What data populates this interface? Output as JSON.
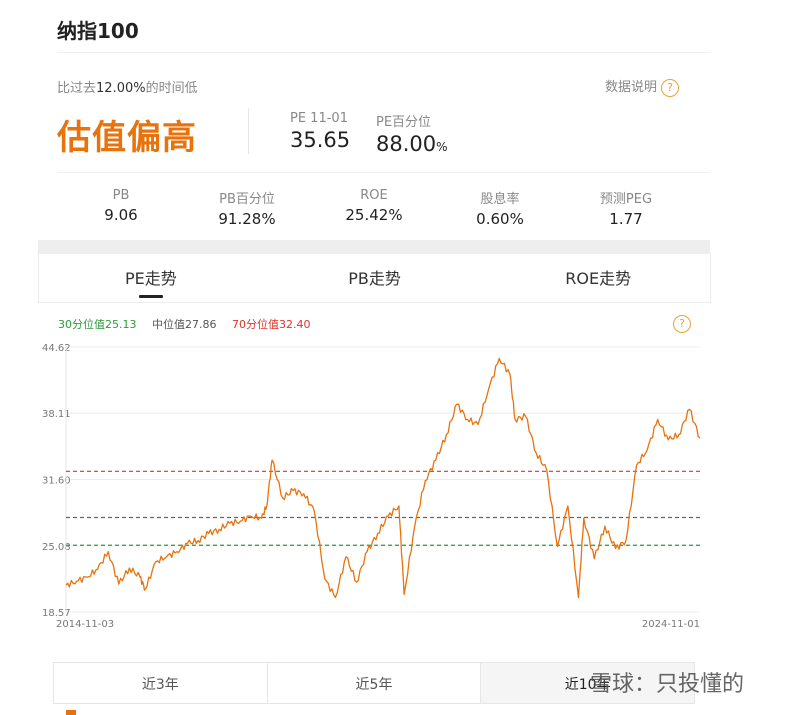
{
  "header": {
    "title": "纳指100"
  },
  "valuation": {
    "subtitle_prefix": "比过去",
    "subtitle_percent": "12.00%",
    "subtitle_suffix": "的时间低",
    "help_label": "数据说明",
    "status": "估值偏高",
    "pe_label": "PE 11-01",
    "pe_value": "35.65",
    "pe_percentile_label": "PE百分位",
    "pe_percentile_value": "88.00",
    "pe_percentile_unit": "%"
  },
  "stats": [
    {
      "label": "PB",
      "value": "9.06"
    },
    {
      "label": "PB百分位",
      "value": "91.28%"
    },
    {
      "label": "ROE",
      "value": "25.42%"
    },
    {
      "label": "股息率",
      "value": "0.60%"
    },
    {
      "label": "预测PEG",
      "value": "1.77"
    }
  ],
  "tabs": [
    {
      "label": "PE走势",
      "active": true
    },
    {
      "label": "PB走势",
      "active": false
    },
    {
      "label": "ROE走势",
      "active": false
    }
  ],
  "legend": {
    "p30": "30分位值25.13",
    "median": "中位值27.86",
    "p70": "70分位值32.40",
    "colors": {
      "p30": "#2e9a3c",
      "median": "#666666",
      "p70": "#d9342b",
      "line": "#e8720c"
    }
  },
  "periods": [
    "近3年",
    "近5年",
    "近10年"
  ],
  "watermark": "雪球：只投懂的",
  "chart_data": {
    "type": "line",
    "title": "",
    "xlabel": "",
    "ylabel": "",
    "x_start": "2014-11-03",
    "x_end": "2024-11-01",
    "yticks": [
      18.57,
      25.08,
      31.6,
      38.11,
      44.62
    ],
    "ytick_labels": [
      "18.57",
      "25.08",
      "31.60",
      "38.11",
      "44.62"
    ],
    "ylim": [
      18.57,
      44.62
    ],
    "grid": true,
    "reference_lines": [
      {
        "name": "30分位值",
        "value": 25.13,
        "color": "#2e9a3c"
      },
      {
        "name": "中位值",
        "value": 27.86,
        "color": "#666666"
      },
      {
        "name": "70分位值",
        "value": 32.4,
        "color": "#d9342b"
      }
    ],
    "series": [
      {
        "x": [
          "2014-11",
          "2015-01",
          "2015-03",
          "2015-05",
          "2015-07",
          "2015-09",
          "2015-11",
          "2016-01",
          "2016-02",
          "2016-04",
          "2016-06",
          "2016-08",
          "2016-10",
          "2016-12",
          "2017-02",
          "2017-04",
          "2017-06",
          "2017-08",
          "2017-10",
          "2017-12",
          "2018-01",
          "2018-02",
          "2018-04",
          "2018-06",
          "2018-08",
          "2018-10",
          "2018-12",
          "2019-02",
          "2019-04",
          "2019-06",
          "2019-08",
          "2019-10",
          "2019-12",
          "2020-02",
          "2020-03",
          "2020-05",
          "2020-07",
          "2020-09",
          "2020-11",
          "2021-01",
          "2021-03",
          "2021-05",
          "2021-07",
          "2021-09",
          "2021-11",
          "2021-12",
          "2022-02",
          "2022-04",
          "2022-06",
          "2022-08",
          "2022-10",
          "2022-12",
          "2023-01",
          "2023-03",
          "2023-05",
          "2023-07",
          "2023-09",
          "2023-11",
          "2024-01",
          "2024-03",
          "2024-05",
          "2024-07",
          "2024-09",
          "2024-11"
        ],
        "values": [
          21.2,
          21.6,
          22.0,
          22.8,
          24.5,
          21.3,
          22.9,
          22.0,
          20.8,
          23.5,
          24.0,
          24.5,
          25.3,
          25.6,
          26.3,
          26.7,
          27.3,
          27.5,
          28.0,
          27.8,
          29.0,
          33.5,
          29.8,
          30.5,
          30.2,
          28.5,
          21.8,
          20.0,
          24.0,
          21.5,
          24.5,
          26.3,
          28.0,
          29.0,
          20.3,
          27.0,
          31.5,
          33.5,
          36.0,
          39.0,
          37.5,
          37.0,
          40.5,
          43.5,
          42.0,
          37.5,
          37.8,
          34.2,
          32.5,
          25.0,
          29.0,
          20.0,
          27.8,
          23.8,
          27.0,
          24.8,
          25.6,
          33.0,
          34.5,
          37.5,
          35.5,
          36.0,
          38.5,
          35.65
        ]
      }
    ]
  }
}
